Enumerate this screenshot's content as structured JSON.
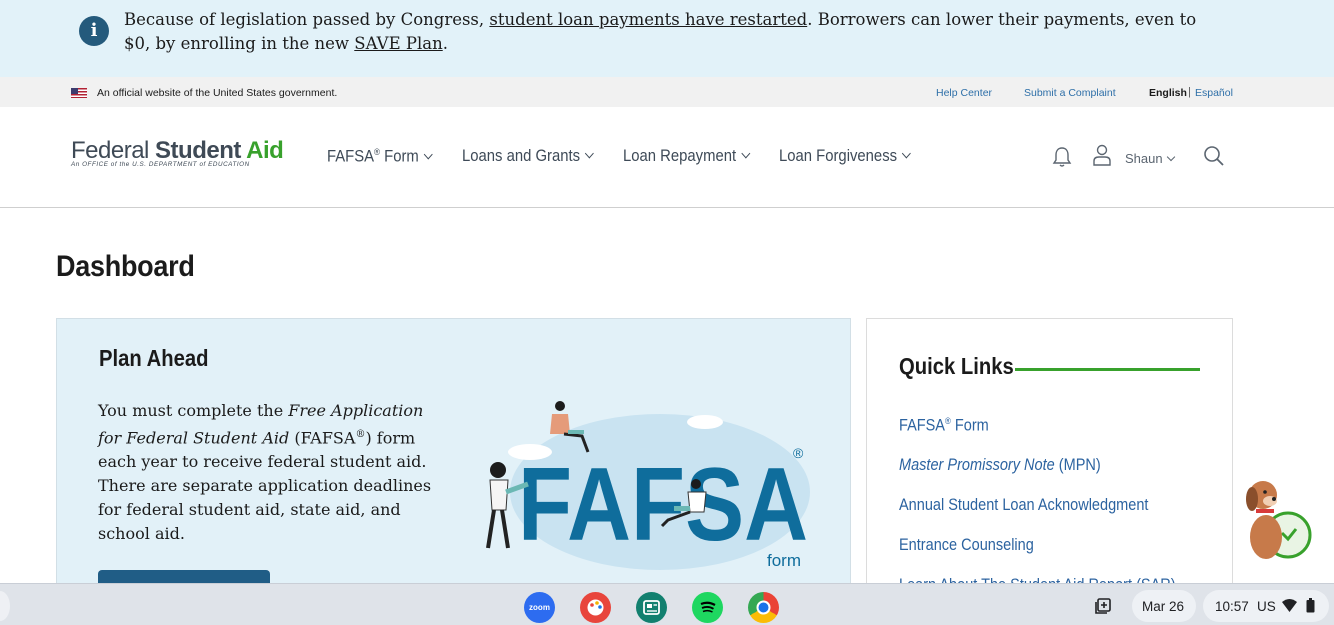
{
  "alert": {
    "text_before": "Because of legislation passed by Congress, ",
    "link1": "student loan payments have restarted",
    "text_middle": ". Borrowers can lower their payments, even to $0, by enrolling in the new ",
    "link2": "SAVE Plan",
    "text_after": "."
  },
  "official_bar": {
    "text": "An official website of the United States government.",
    "help_center": "Help Center",
    "submit_complaint": "Submit a Complaint",
    "lang_english": "English",
    "separator": "|",
    "lang_spanish": "Español"
  },
  "header": {
    "logo_federal": "Federal ",
    "logo_student": "Student ",
    "logo_aid": "Aid",
    "logo_sub": "An OFFICE of the U.S. DEPARTMENT of EDUCATION",
    "nav": [
      {
        "label": "FAFSA",
        "reg": "®",
        "label_suffix": " Form"
      },
      {
        "label": "Loans and Grants"
      },
      {
        "label": "Loan Repayment"
      },
      {
        "label": "Loan Forgiveness"
      }
    ],
    "user_name": "Shaun"
  },
  "page": {
    "title": "Dashboard"
  },
  "plan_ahead": {
    "title": "Plan Ahead",
    "body_1": "You must complete the ",
    "body_em": "Free Application for Federal Student Aid",
    "body_2": " (FAFSA",
    "body_reg": "®",
    "body_3": ") form each year to receive federal student aid. There are separate application deadlines for federal student aid, state aid, and school aid.",
    "fafsa_logo": "FAFSA",
    "fafsa_reg": "®",
    "fafsa_form": "form"
  },
  "quick_links": {
    "title": "Quick Links",
    "items": [
      {
        "label": "FAFSA",
        "reg": "®",
        "suffix": " Form"
      },
      {
        "label_em": "Master Promissory Note",
        "suffix": " (MPN)"
      },
      {
        "label": "Annual Student Loan Acknowledgment"
      },
      {
        "label": "Entrance Counseling"
      },
      {
        "label": "Learn About The Student Aid Report (SAR)"
      }
    ]
  },
  "taskbar": {
    "apps": [
      "zoom",
      "color-palette",
      "news-reader",
      "spotify",
      "chrome"
    ],
    "zoom_label": "zoom",
    "date": "Mar 26",
    "time": "10:57",
    "ime": "US"
  },
  "colors": {
    "alert_bg": "#e2f2f9",
    "brand_green": "#38a12c",
    "link_blue": "#2c63a0",
    "fafsa_blue": "#0f6d9c",
    "button_blue": "#205d86"
  }
}
